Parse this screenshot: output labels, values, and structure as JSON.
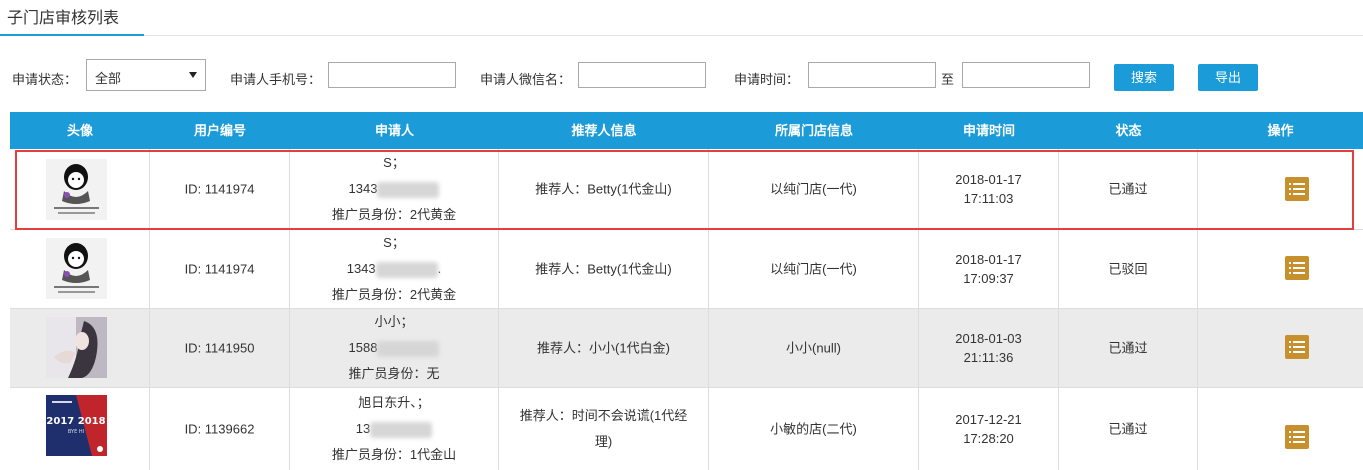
{
  "tab": {
    "title": "子门店审核列表"
  },
  "filters": {
    "status_label": "申请状态：",
    "status_value": "全部",
    "phone_label": "申请人手机号：",
    "phone_value": "",
    "wechat_label": "申请人微信名：",
    "wechat_value": "",
    "time_label": "申请时间：",
    "time_start": "",
    "time_to": "至",
    "time_end": "",
    "search_label": "搜索",
    "export_label": "导出"
  },
  "table": {
    "headers": [
      "头像",
      "用户编号",
      "申请人",
      "推荐人信息",
      "所属门店信息",
      "申请时间",
      "状态",
      "操作"
    ],
    "rows": [
      {
        "id": "ID: 1141974",
        "name": "S；",
        "phone": "1343",
        "phone_tail": "",
        "identity": "推广员身份：2代黄金",
        "referrer": "推荐人：Betty(1代金山)",
        "store": "以纯门店(一代)",
        "date": "2018-01-17",
        "time": "17:11:03",
        "status": "已通过"
      },
      {
        "id": "ID: 1141974",
        "name": "S；",
        "phone": "1343",
        "phone_tail": ".",
        "identity": "推广员身份：2代黄金",
        "referrer": "推荐人：Betty(1代金山)",
        "store": "以纯门店(一代)",
        "date": "2018-01-17",
        "time": "17:09:37",
        "status": "已驳回"
      },
      {
        "id": "ID: 1141950",
        "name": "小小；",
        "phone": "1588",
        "phone_tail": "",
        "identity": "推广员身份：无",
        "referrer": "推荐人：小小(1代白金)",
        "store": "小小(null)",
        "date": "2018-01-03",
        "time": "21:11:36",
        "status": "已通过"
      },
      {
        "id": "ID: 1139662",
        "name": "旭日东升、；",
        "phone": "13",
        "phone_tail": "",
        "identity": "推广员身份：1代金山",
        "referrer_line1": "推荐人：时间不会说谎(1代经",
        "referrer_line2": "理)",
        "store": "小敏的店(二代)",
        "date": "2017-12-21",
        "time": "17:28:20",
        "status": "已通过"
      }
    ]
  },
  "avatar_overlay": {
    "line1": "2017 2018",
    "line2": "BYE HI"
  },
  "colors": {
    "header_blue": "#1b9bd8",
    "action_gold": "#c7902c",
    "highlight_red": "#e43e3e",
    "alt_row": "#ebebeb"
  },
  "icons": {
    "action": "list-icon"
  }
}
